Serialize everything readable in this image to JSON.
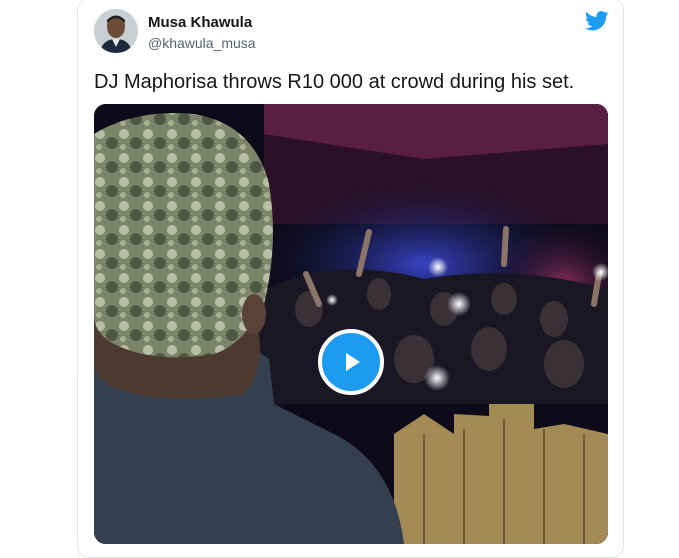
{
  "tweet": {
    "author": {
      "name": "Musa Khawula",
      "handle": "@khawula_musa"
    },
    "text": "DJ Maphorisa throws R10 000 at crowd during his set.",
    "media": {
      "type": "video",
      "play_icon": "play-icon"
    }
  },
  "colors": {
    "twitter_blue": "#1d9bf0",
    "name_text": "#14171a",
    "handle_text": "#536471",
    "border": "#e1e8ed"
  },
  "icons": {
    "brand": "twitter-bird-icon"
  }
}
